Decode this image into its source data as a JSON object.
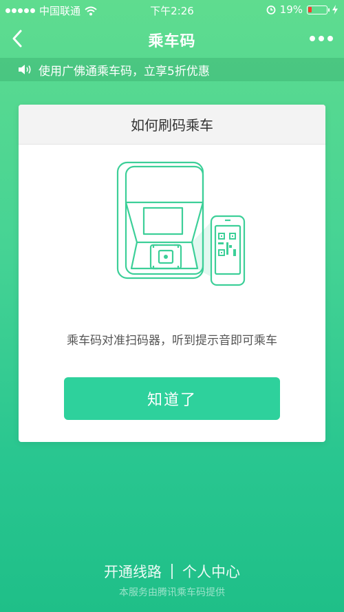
{
  "status_bar": {
    "carrier": "中国联通",
    "time": "下午2:26",
    "battery_percent": "19%",
    "battery_level": 0.19
  },
  "nav": {
    "title": "乘车码"
  },
  "notice": {
    "text": "使用广佛通乘车码，立享5折优惠"
  },
  "card": {
    "title": "如何刷码乘车",
    "description": "乘车码对准扫码器，听到提示音即可乘车",
    "button_label": "知道了"
  },
  "footer": {
    "link_routes": "开通线路",
    "link_profile": "个人中心",
    "note": "本服务由腾讯乘车码提供"
  },
  "colors": {
    "accent": "#2ed19c",
    "illustration": "#3ccf98",
    "battery_low": "#ff3b30"
  },
  "icons": {
    "back": "chevron-left-icon",
    "more": "more-dots-icon",
    "notice": "speaker-icon",
    "wifi": "wifi-icon",
    "alarm": "alarm-icon",
    "charging": "bolt-icon"
  }
}
